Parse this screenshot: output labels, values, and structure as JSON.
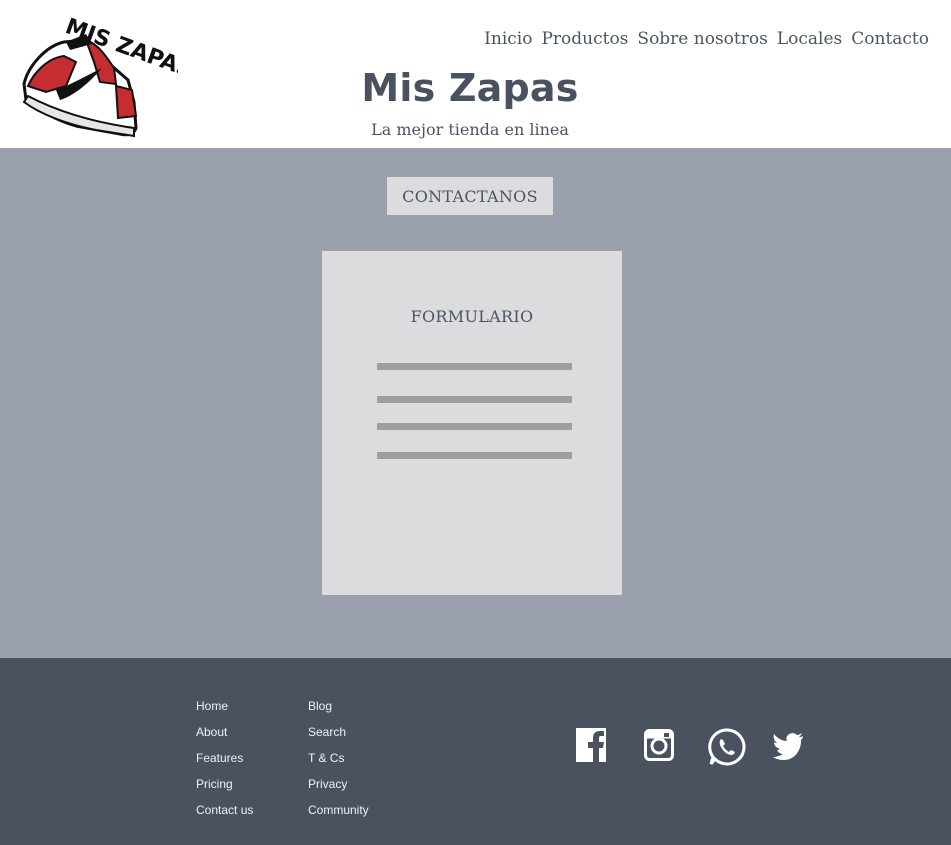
{
  "header": {
    "logo_text": "MIS ZAPAS",
    "nav": [
      "Inicio",
      "Productos",
      "Sobre nosotros",
      "Locales",
      "Contacto"
    ],
    "title": "Mis Zapas",
    "subtitle": "La mejor tienda en linea"
  },
  "main": {
    "contact_button": "CONTACTANOS",
    "form_title": "FORMULARIO"
  },
  "footer": {
    "col1": [
      "Home",
      "About",
      "Features",
      "Pricing",
      "Contact us"
    ],
    "col2": [
      "Blog",
      "Search",
      "T & Cs",
      "Privacy",
      "Community"
    ],
    "social_icons": [
      "facebook-icon",
      "instagram-icon",
      "whatsapp-icon",
      "twitter-icon"
    ]
  },
  "colors": {
    "main_bg": "#9aa1ac",
    "footer_bg": "#4a5260",
    "card_bg": "#dcdcde",
    "text": "#4b5563"
  }
}
